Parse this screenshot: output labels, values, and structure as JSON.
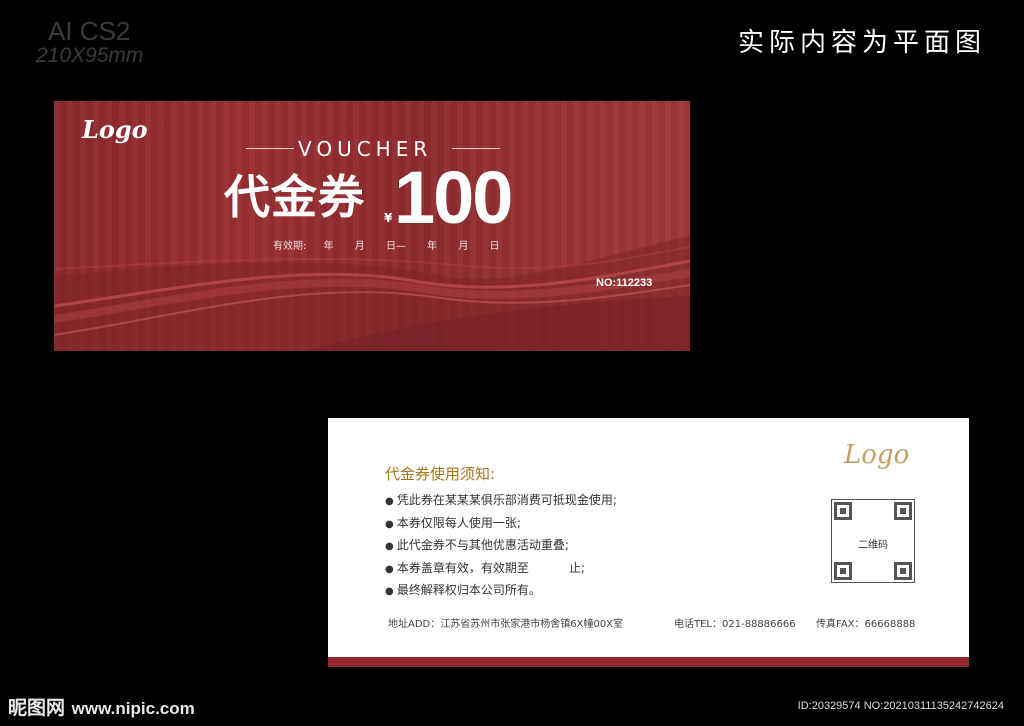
{
  "spec": {
    "software": "AI CS2",
    "size": "210X95mm"
  },
  "note": "实际内容为平面图",
  "front": {
    "logo": "Logo",
    "voucher_word": "VOUCHER",
    "title": "代金券",
    "currency": "¥",
    "amount": "100",
    "validity_label": "有效期:",
    "validity_parts": [
      "年",
      "月",
      "日—",
      "年",
      "月",
      "日"
    ],
    "serial": "NO:112233"
  },
  "back": {
    "logo": "Logo",
    "rules_title": "代金券使用须知:",
    "rules": [
      "凭此券在某某某俱乐部消费可抵现金使用;",
      "本券仅限每人使用一张;",
      "此代金券不与其他优惠活动重叠;",
      "本券盖章有效，有效期至",
      "最终解释权归本公司所有。"
    ],
    "rule4_suffix": "止;",
    "qr_label": "二维码",
    "address": "地址ADD：江苏省苏州市张家港市杨舍镇6X幢00X室",
    "tel": "电话TEL：021-88886666",
    "fax": "传真FAX：66668888"
  },
  "watermark": {
    "brand": "昵图网",
    "site": "www.nipic.com"
  },
  "image_id": "ID:20329574 NO:20210311135242742624",
  "colors": {
    "card_red": "#93292e",
    "gold": "#a4771f",
    "logo_gold": "#c3a06a"
  }
}
